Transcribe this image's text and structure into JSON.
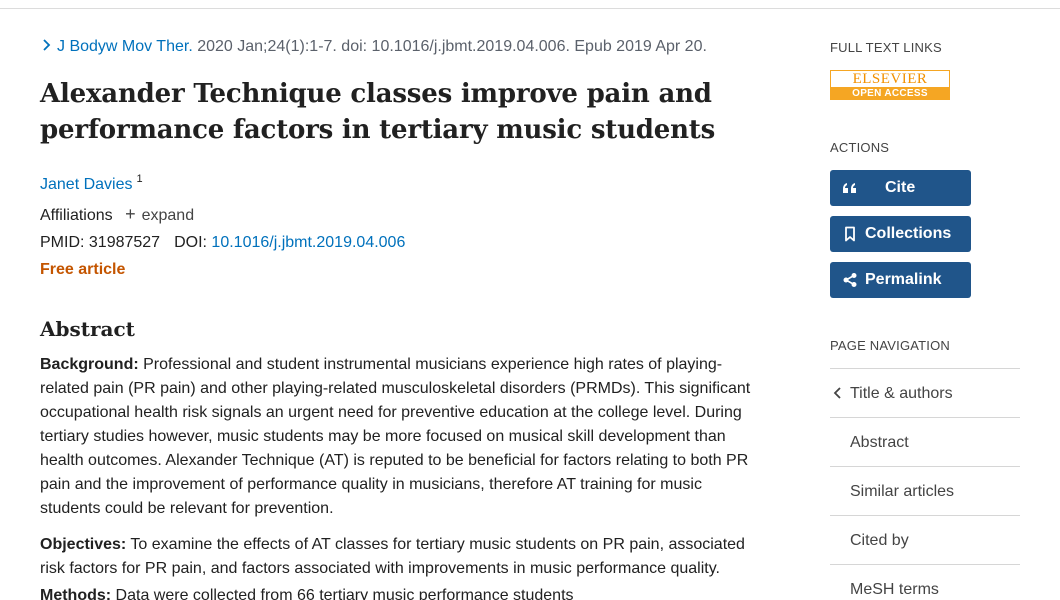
{
  "citation": {
    "journal": "J Bodyw Mov Ther.",
    "details": " 2020 Jan;24(1):1-7. doi: 10.1016/j.jbmt.2019.04.006. Epub 2019 Apr 20."
  },
  "article": {
    "title": "Alexander Technique classes improve pain and performance factors in tertiary music students",
    "author": "Janet Davies",
    "author_sup": "1",
    "affiliations_label": "Affiliations",
    "expand_label": "expand",
    "pmid_label": "PMID: ",
    "pmid": "31987527",
    "doi_label": "DOI: ",
    "doi": "10.1016/j.jbmt.2019.04.006",
    "free_label": "Free article"
  },
  "abstract": {
    "heading": "Abstract",
    "background_label": "Background:",
    "background_text": " Professional and student instrumental musicians experience high rates of playing-related pain (PR pain) and other playing-related musculoskeletal disorders (PRMDs). This significant occupational health risk signals an urgent need for preventive education at the college level. During tertiary studies however, music students may be more focused on musical skill development than health outcomes. Alexander Technique (AT) is reputed to be beneficial for factors relating to both PR pain and the improvement of performance quality in musicians, therefore AT training for music students could be relevant for prevention.",
    "objectives_label": "Objectives:",
    "objectives_text": " To examine the effects of AT classes for tertiary music students on PR pain, associated risk factors for PR pain, and factors associated with improvements in music performance quality.",
    "methods_label": "Methods:",
    "methods_text": " Data were collected from 66 tertiary music performance students"
  },
  "sidebar": {
    "full_text_heading": "FULL TEXT LINKS",
    "elsevier_top": "ELSEVIER",
    "elsevier_bottom": "OPEN ACCESS",
    "actions_heading": "ACTIONS",
    "cite_label": "Cite",
    "collections_label": "Collections",
    "permalink_label": "Permalink",
    "nav_heading": "PAGE NAVIGATION",
    "nav_items": [
      "Title & authors",
      "Abstract",
      "Similar articles",
      "Cited by",
      "MeSH terms"
    ]
  },
  "colors": {
    "link": "#0071bc",
    "free": "#c45500",
    "button": "#20558a",
    "elsevier": "#f5a623"
  }
}
